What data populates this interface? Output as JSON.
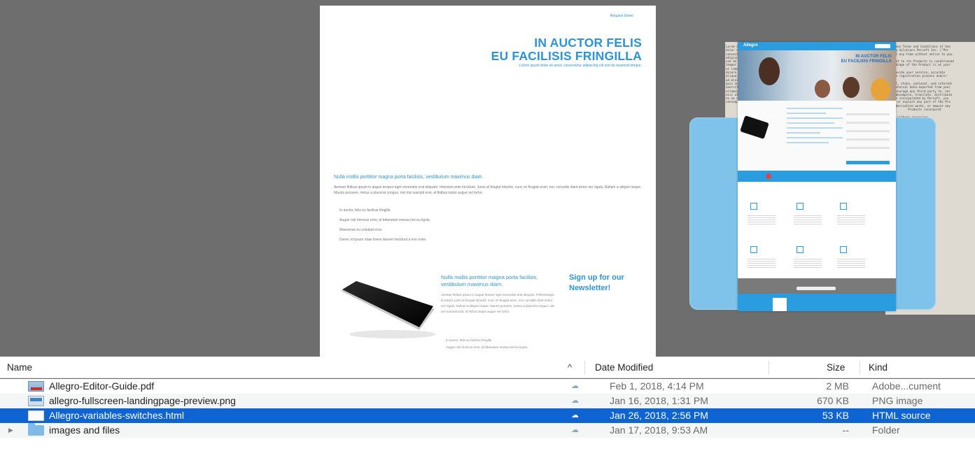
{
  "preview": {
    "page_link": "Request Demo",
    "hero_line1": "IN AUCTOR FELIS",
    "hero_line2": "EU FACILISIS FRINGILLA",
    "hero_sub": "Lorem ipsum dolor sit amet, consectetur adipiscing elit sed do eiusmod tempor.",
    "section_heading": "Nulla mollis porttitor magna porta facilisis, vestibulum maximus diam.",
    "section_body": "Aenean finibus ipsum in augue tempor eget venenatis erat aliquam. Interdum ante tincidunt. Justo at feugiat lobortis, nunc mi feugiat enim, nec convallis diam tortor nec ligula. Nullam a aliquet neque. Mauris posuere, metus a placerat congue, nisi nisi suscipit erat, at finibus turpis augue vel tortor.",
    "bullets": [
      "In auctor, felis eu facilisis fringilla",
      "Augue nisl rhoncus eros, id bibendum massa nisl eu ligula.",
      "Maecenas eu volutpat eros.",
      "Donec id ipsum vitae lorem laoreet tincidunt a non enim."
    ],
    "mid_heading": "Nulla mollis porttitor magna porta facilisis, vestibulum maximus diam.",
    "mid_body": "Aenean finibus ipsum in augue tempor eget venenatis erat aliquam. Pellentesque tincidunt, justo at feugiat lobortis, nunc mi feugiat enim, nec convallis diam tortor nec ligula. Nullam a aliquet neque. Mauris posuere, metus a placerat congue, nisi nisi suscipit erat, at finibus turpis augue vel tortor.",
    "mid_bullets": [
      "In auctor, felis eu facilisis fringilla",
      "Augue nisl rhoncus eros, id bibendum massa nisl eu ligula."
    ],
    "newsletter": "Sign up for our Newsletter!",
    "site_logo": "Allegro",
    "site_hero_line1": "IN AUCTOR FELIS",
    "site_hero_line2": "EU FACILISIS FRINGILLA"
  },
  "list": {
    "columns": {
      "name": "Name",
      "sort_indicator": "^",
      "date": "Date Modified",
      "size": "Size",
      "kind": "Kind"
    },
    "rows": [
      {
        "name": "Allegro-Editor-Guide.pdf",
        "date": "Feb 1, 2018, 4:14 PM",
        "size": "2 MB",
        "kind": "Adobe...cument",
        "icon": "pdf-file-icon",
        "selected": false
      },
      {
        "name": "allegro-fullscreen-landingpage-preview.png",
        "date": "Jan 16, 2018, 1:31 PM",
        "size": "670 KB",
        "kind": "PNG image",
        "icon": "png-file-icon",
        "selected": false
      },
      {
        "name": "Allegro-variables-switches.html",
        "date": "Jan 26, 2018, 2:56 PM",
        "size": "53 KB",
        "kind": "HTML source",
        "icon": "html-file-icon",
        "selected": true
      },
      {
        "name": "images and files",
        "date": "Jan 17, 2018, 9:53 AM",
        "size": "--",
        "kind": "Folder",
        "icon": "folder-icon",
        "selected": false
      }
    ]
  },
  "colors": {
    "selection": "#0d64d2",
    "accent_blue": "#2a95db",
    "preview_background": "#6e6e6e"
  }
}
